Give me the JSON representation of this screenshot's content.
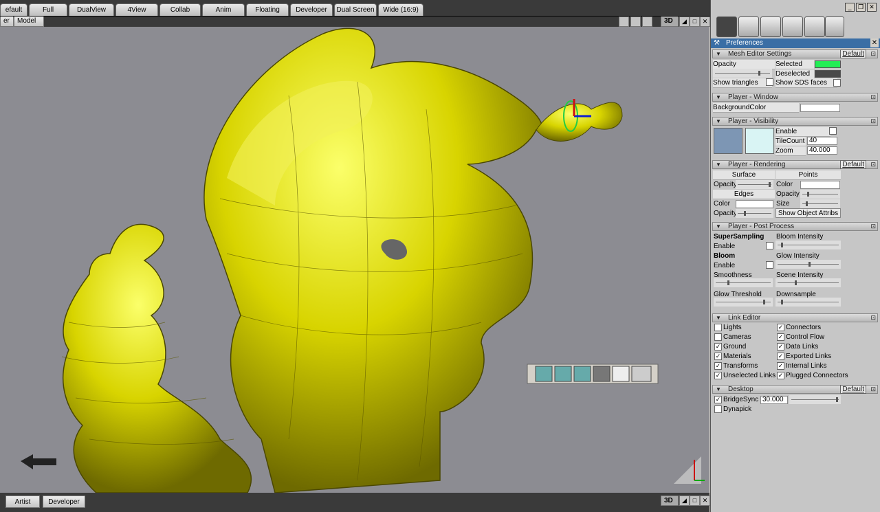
{
  "layout_tabs": [
    "efault",
    "Full",
    "DualView",
    "4View",
    "Collab",
    "Anim",
    "Floating",
    "Developer",
    "Dual Screen",
    "Wide (16:9)"
  ],
  "view_tabs": [
    "er",
    "Model"
  ],
  "view_mode": "3D",
  "bottom_tabs": [
    "Artist",
    "Developer"
  ],
  "bottom_view_mode": "3D",
  "panel": {
    "title": "Preferences",
    "default_label": "Default",
    "mesh_editor": {
      "title": "Mesh Editor Settings",
      "opacity": "Opacity",
      "selected": "Selected",
      "deselected": "Deselected",
      "show_triangles": "Show triangles",
      "show_sds": "Show SDS faces",
      "selected_color": "#22ee55",
      "deselected_color": "#4a4a4a"
    },
    "player_window": {
      "title": "Player - Window",
      "bg_color": "BackgroundColor"
    },
    "player_visibility": {
      "title": "Player - Visibility",
      "enable": "Enable",
      "tilecount_label": "TileCount",
      "tilecount_value": "40",
      "zoom_label": "Zoom",
      "zoom_value": "40.000",
      "swatch1": "#7d96b4",
      "swatch2": "#d9f4f4"
    },
    "player_rendering": {
      "title": "Player - Rendering",
      "surface": "Surface",
      "points": "Points",
      "opacity": "Opacity",
      "color": "Color",
      "edges": "Edges",
      "size": "Size",
      "show_object_attribs": "Show Object Attribs"
    },
    "post_process": {
      "title": "Player - Post Process",
      "supersampling": "SuperSampling",
      "bloom_intensity": "Bloom Intensity",
      "enable": "Enable",
      "bloom": "Bloom",
      "glow_intensity": "Glow Intensity",
      "smoothness": "Smoothness",
      "scene_intensity": "Scene Intensity",
      "glow_threshold": "Glow Threshold",
      "downsample": "Downsample"
    },
    "link_editor": {
      "title": "Link Editor",
      "left": [
        {
          "label": "Lights",
          "checked": false
        },
        {
          "label": "Cameras",
          "checked": false
        },
        {
          "label": "Ground",
          "checked": true
        },
        {
          "label": "Materials",
          "checked": true
        },
        {
          "label": "Transforms",
          "checked": true
        },
        {
          "label": "Unselected Links",
          "checked": true
        }
      ],
      "right": [
        {
          "label": "Connectors",
          "checked": true
        },
        {
          "label": "Control Flow",
          "checked": true
        },
        {
          "label": "Data Links",
          "checked": true
        },
        {
          "label": "Exported Links",
          "checked": true
        },
        {
          "label": "Internal Links",
          "checked": true
        },
        {
          "label": "Plugged Connectors",
          "checked": true
        }
      ]
    },
    "desktop": {
      "title": "Desktop",
      "bridgesync": "BridgeSync",
      "bridgesync_value": "30.000",
      "dynapick": "Dynapick"
    }
  }
}
